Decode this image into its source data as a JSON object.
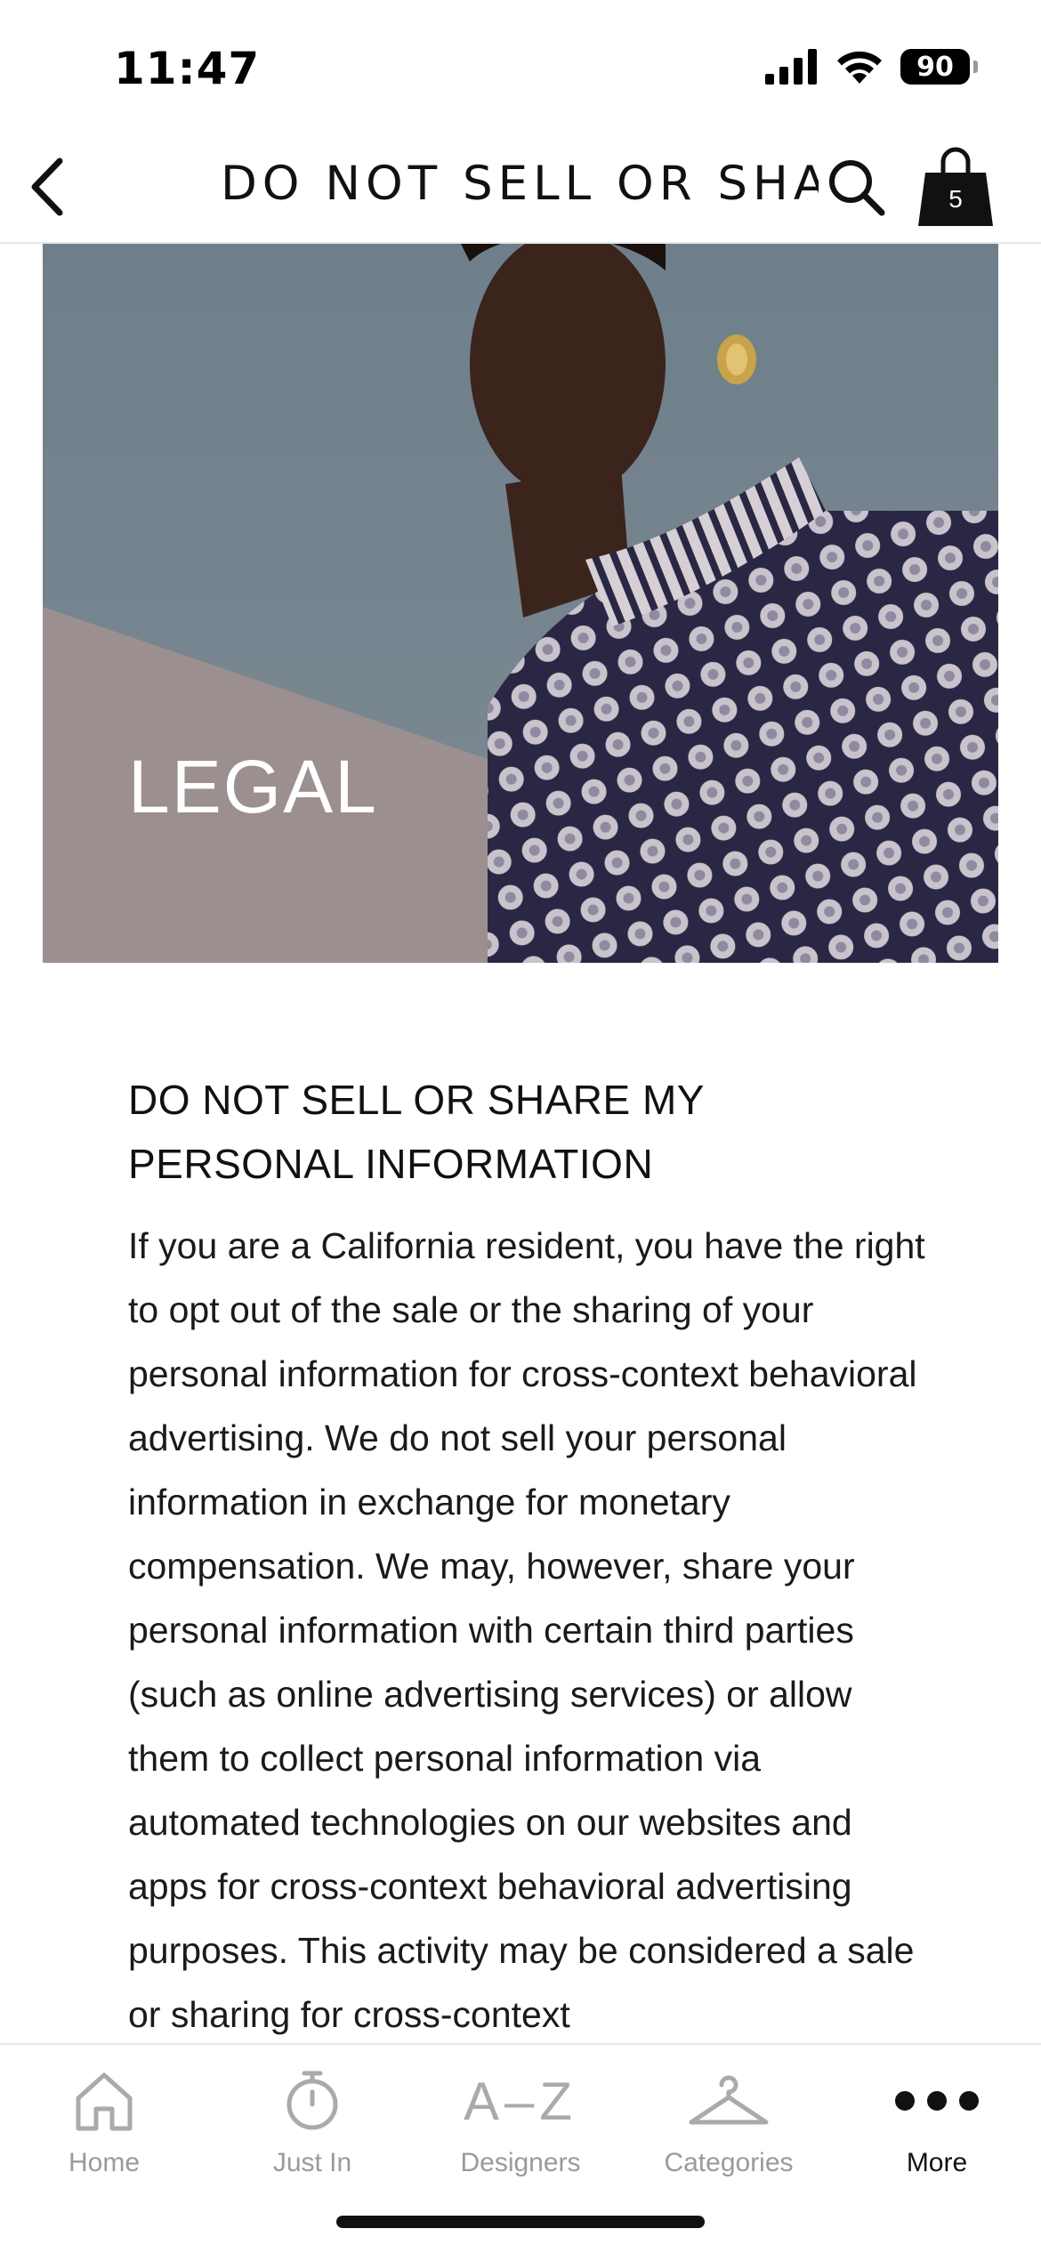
{
  "status_bar": {
    "time": "11:47",
    "battery": "90"
  },
  "header": {
    "title": "DO NOT SELL OR SHA…",
    "bag_count": "5"
  },
  "hero": {
    "title": "LEGAL"
  },
  "content": {
    "heading": "DO NOT SELL OR SHARE MY PERSONAL INFORMATION",
    "body": "If you are a California resident, you have the right to opt out of the sale or the sharing of your personal information for cross-context behavioral advertising. We do not sell your personal information in exchange for monetary compensation. We may, however, share your personal information with certain third parties (such as online advertising services) or allow them to collect personal information via automated technologies on our websites and apps for cross-context behavioral advertising purposes. This activity may be considered a sale or sharing for cross-context"
  },
  "tabs": [
    {
      "label": "Home",
      "icon": "home-icon",
      "active": false
    },
    {
      "label": "Just In",
      "icon": "stopwatch-icon",
      "active": false
    },
    {
      "label": "Designers",
      "icon": "a-z-icon",
      "glyph": "A–Z",
      "active": false
    },
    {
      "label": "Categories",
      "icon": "hanger-icon",
      "active": false
    },
    {
      "label": "More",
      "icon": "more-dots-icon",
      "active": true
    }
  ]
}
